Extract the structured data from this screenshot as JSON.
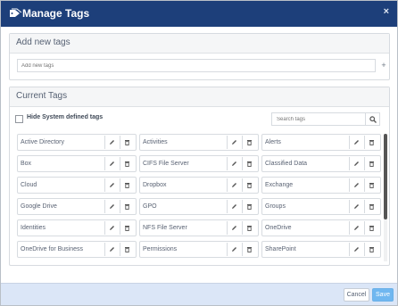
{
  "header": {
    "title": "Manage Tags",
    "close": "×"
  },
  "add_section": {
    "title": "Add new tags",
    "placeholder": "Add new tags",
    "plus": "+"
  },
  "current_section": {
    "title": "Current Tags",
    "hide_label": "Hide System defined tags",
    "search_placeholder": "Search tags"
  },
  "tags": [
    "Active Directory",
    "Activities",
    "Alerts",
    "Box",
    "CIFS File Server",
    "Classified Data",
    "Cloud",
    "Dropbox",
    "Exchange",
    "Google Drive",
    "GPO",
    "Groups",
    "Identities",
    "NFS File Server",
    "OneDrive",
    "OneDrive for Business",
    "Permissions",
    "SharePoint"
  ],
  "footer": {
    "cancel": "Cancel",
    "save": "Save"
  },
  "colors": {
    "header": "#1d3f7a",
    "footer": "#dbe6f7",
    "save_button": "#70b7f0"
  },
  "icons": {
    "header": "tag-icon",
    "close": "close-icon",
    "edit": "pencil-icon",
    "delete": "trash-icon",
    "search": "search-icon",
    "add": "plus-icon"
  }
}
